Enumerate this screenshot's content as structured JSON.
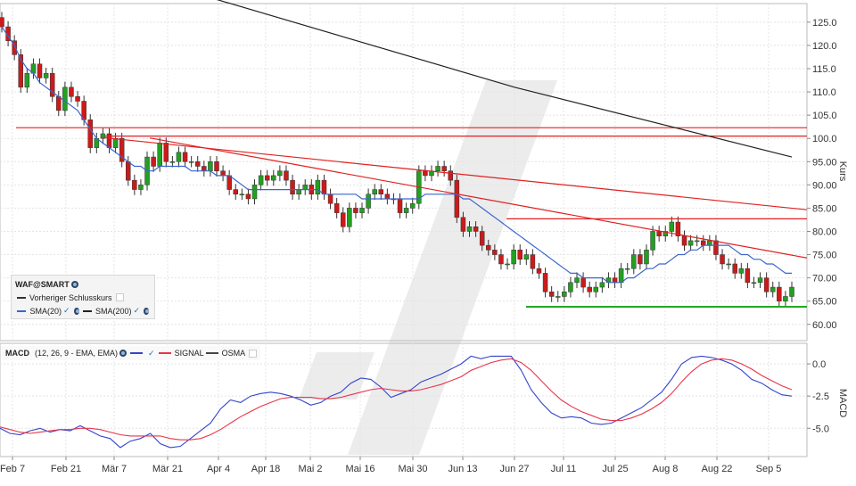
{
  "chart_data": [
    {
      "type": "candlestick",
      "panel": "price",
      "ylabel": "Kurs",
      "ylim": [
        56.5,
        129
      ],
      "yticks": [
        "60.00",
        "65.00",
        "70.00",
        "75.00",
        "80.00",
        "85.00",
        "90.00",
        "95.00",
        "100.0",
        "105.0",
        "110.0",
        "115.0",
        "120.0",
        "125.0"
      ],
      "xticks": [
        "Feb 7",
        "Feb 21",
        "Mär 7",
        "Mär 21",
        "Apr 4",
        "Apr 18",
        "Mai 2",
        "Mai 16",
        "Mai 30",
        "Jun 13",
        "Jun 27",
        "Jul 11",
        "Jul 25",
        "Aug 8",
        "Aug 22",
        "Sep 5"
      ],
      "legend": {
        "title": "WAF@SMART",
        "items": [
          {
            "label": "Vorheriger Schlusskurs",
            "color": "#333333",
            "style": "dashed"
          },
          {
            "label": "SMA(20)",
            "color": "#3a66cc"
          },
          {
            "label": "SMA(200)",
            "color": "#222222"
          }
        ]
      },
      "closes": [
        124,
        121,
        118,
        111,
        114,
        116,
        113,
        114,
        109,
        106,
        111,
        109,
        108,
        104,
        98,
        100,
        101,
        98,
        100,
        95,
        91,
        89,
        90,
        96,
        94,
        99,
        95,
        95,
        97,
        95,
        95,
        94,
        93,
        95,
        93,
        92,
        89,
        88,
        88,
        87,
        90,
        92,
        91,
        92,
        93,
        91,
        88,
        89,
        90,
        88,
        91,
        88,
        86,
        84,
        81,
        85,
        84,
        85,
        88,
        89,
        88,
        87,
        87,
        84,
        85,
        86,
        93,
        92,
        93,
        94,
        93,
        91,
        83,
        80,
        81,
        80,
        77,
        76,
        75,
        73,
        73,
        76,
        74,
        75,
        72,
        71,
        67,
        66,
        66,
        67,
        69,
        70,
        68,
        67,
        68,
        69,
        70,
        69,
        72,
        72,
        75,
        73,
        76,
        80,
        79,
        80,
        82,
        79,
        77,
        78,
        78,
        77,
        78,
        75,
        73,
        73,
        71,
        72,
        69,
        69,
        70,
        67,
        68,
        65,
        66,
        68
      ],
      "sma20": [
        124,
        122,
        120,
        117,
        115,
        114,
        112,
        111,
        110,
        109,
        108,
        107,
        106,
        104,
        102,
        100,
        99,
        98,
        97,
        96,
        95,
        94,
        94,
        93,
        93,
        94,
        94,
        94,
        94,
        94,
        93,
        93,
        93,
        93,
        92,
        92,
        92,
        91,
        90,
        89,
        89,
        89,
        89,
        89,
        89,
        89,
        89,
        89,
        89,
        89,
        89,
        88,
        88,
        88,
        88,
        88,
        88,
        87,
        87,
        87,
        87,
        87,
        87,
        87,
        87,
        87,
        87,
        88,
        88,
        88,
        88,
        88,
        88,
        87,
        87,
        86,
        85,
        84,
        83,
        82,
        81,
        80,
        79,
        78,
        77,
        76,
        75,
        74,
        73,
        72,
        71,
        71,
        70,
        70,
        70,
        70,
        69,
        69,
        69,
        70,
        70,
        71,
        72,
        72,
        73,
        73,
        74,
        75,
        75,
        76,
        76,
        77,
        77,
        77,
        77,
        77,
        76,
        75,
        75,
        74,
        74,
        73,
        73,
        72,
        71,
        71
      ],
      "sma200": [
        {
          "x": "Mär 21",
          "y": 130.5
        },
        {
          "x": "Jun 27",
          "y": 111
        },
        {
          "x": "Sep 5",
          "y": 96
        }
      ],
      "hlines": [
        {
          "y": 102.3,
          "color": "#e02020"
        },
        {
          "y": 100.5,
          "color": "#e02020"
        },
        {
          "y": 82.7,
          "color": "#e02020"
        },
        {
          "y": 63.8,
          "color": "#22aa22"
        }
      ],
      "trendlines": [
        {
          "x1": "Feb 21",
          "y1": 101,
          "x2": "Sep 5",
          "y2": 85.5,
          "color": "#e02020"
        },
        {
          "x1": "Mär 7",
          "y1": 101.5,
          "x2": "Sep 5",
          "y2": 75.8,
          "color": "#e02020"
        }
      ]
    },
    {
      "type": "line",
      "panel": "macd",
      "title": "MACD",
      "ylabel": "MACD",
      "params": "(12, 26, 9 - EMA, EMA)",
      "ylim": [
        -7.2,
        1.6
      ],
      "yticks": [
        "0.0",
        "-2.5",
        "-5.0"
      ],
      "series": [
        {
          "name": "MACD",
          "color": "#3344cc",
          "values": [
            -5,
            -5.4,
            -5.5,
            -5.2,
            -5,
            -5.3,
            -5.1,
            -5.2,
            -4.8,
            -5.2,
            -5.6,
            -5.8,
            -6.5,
            -6,
            -5.8,
            -5.4,
            -6.2,
            -6.5,
            -6.4,
            -5.8,
            -5.2,
            -4.6,
            -3.5,
            -2.8,
            -3,
            -2.5,
            -2.3,
            -2.2,
            -2.3,
            -2.5,
            -2.8,
            -3.2,
            -3,
            -2.5,
            -2.2,
            -1.5,
            -1.1,
            -1.2,
            -1.8,
            -2.6,
            -2.3,
            -2,
            -1.4,
            -1.1,
            -0.8,
            -0.4,
            0,
            0.6,
            0.4,
            0.6,
            0.6,
            0.6,
            -0.5,
            -2,
            -3,
            -3.8,
            -4.2,
            -4.1,
            -4.2,
            -4.6,
            -4.7,
            -4.6,
            -4.2,
            -3.8,
            -3.4,
            -2.8,
            -2.2,
            -1.2,
            0,
            0.5,
            0.6,
            0.5,
            0.3,
            0,
            -0.5,
            -1.2,
            -1.5,
            -2,
            -2.4,
            -2.5
          ]
        },
        {
          "name": "SIGNAL",
          "color": "#e8344a",
          "values": [
            -4.9,
            -5.1,
            -5.3,
            -5.4,
            -5.3,
            -5.2,
            -5.1,
            -5.1,
            -5,
            -5,
            -5.1,
            -5.3,
            -5.5,
            -5.6,
            -5.6,
            -5.6,
            -5.6,
            -5.8,
            -5.9,
            -5.9,
            -5.8,
            -5.5,
            -5.1,
            -4.6,
            -4.1,
            -3.7,
            -3.3,
            -3,
            -2.7,
            -2.6,
            -2.6,
            -2.6,
            -2.7,
            -2.7,
            -2.6,
            -2.4,
            -2.2,
            -2,
            -1.9,
            -2,
            -2.1,
            -2.1,
            -2,
            -1.8,
            -1.6,
            -1.3,
            -1,
            -0.5,
            -0.2,
            0.1,
            0.3,
            0.4,
            0.1,
            -0.5,
            -1.3,
            -2.1,
            -2.8,
            -3.3,
            -3.7,
            -4,
            -4.3,
            -4.4,
            -4.4,
            -4.2,
            -3.9,
            -3.5,
            -3,
            -2.3,
            -1.4,
            -0.6,
            0,
            0.3,
            0.4,
            0.3,
            0,
            -0.4,
            -0.9,
            -1.3,
            -1.7,
            -2
          ]
        },
        {
          "name": "OSMA",
          "color": "#444444",
          "values": []
        }
      ]
    }
  ]
}
